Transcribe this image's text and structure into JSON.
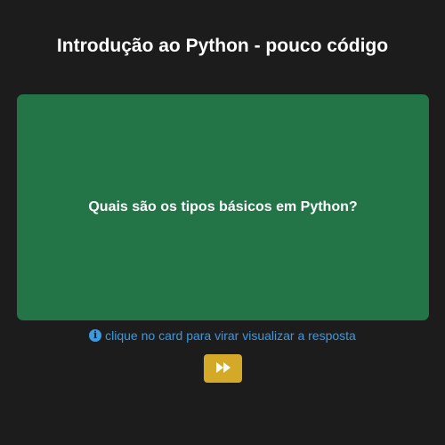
{
  "header": {
    "title": "Introdução ao Python - pouco código"
  },
  "card": {
    "question": "Quais são os tipos básicos em Python?",
    "background_color": "#237548"
  },
  "hint": {
    "icon": "info-icon",
    "text": "clique no card para virar visualizar a resposta",
    "color": "#3b9ae1"
  },
  "controls": {
    "next_icon": "fast-forward-icon",
    "next_button_color": "#d5a928"
  },
  "theme": {
    "background": "#1c1c1c"
  }
}
